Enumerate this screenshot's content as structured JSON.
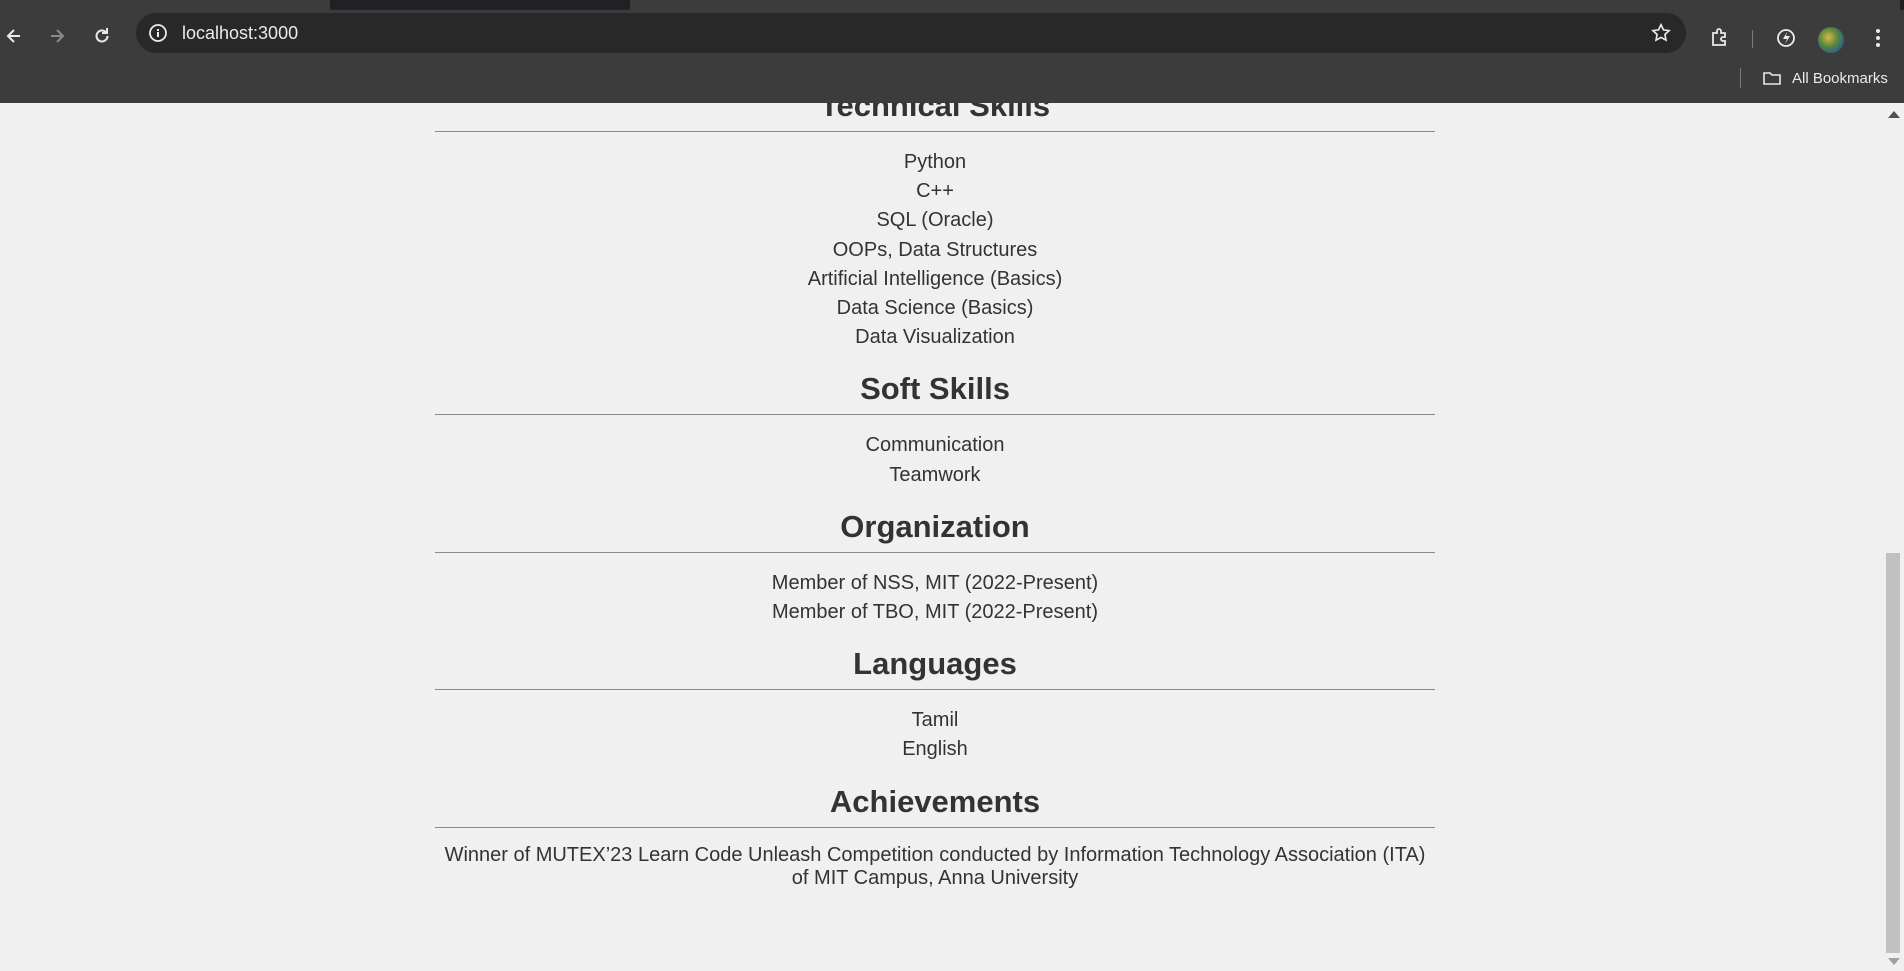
{
  "browser": {
    "url": "localhost:3000",
    "bookmarks_label": "All Bookmarks",
    "icons": [
      "back-icon",
      "forward-icon",
      "reload-icon",
      "site-info-icon",
      "bookmark-star-icon",
      "extensions-icon",
      "performance-icon",
      "profile-avatar",
      "menu-icon",
      "folder-icon"
    ]
  },
  "sections": {
    "technical": {
      "title": "Technical Skills",
      "items": [
        "Python",
        "C++",
        "SQL (Oracle)",
        "OOPs, Data Structures",
        "Artificial Intelligence (Basics)",
        "Data Science (Basics)",
        "Data Visualization"
      ]
    },
    "soft": {
      "title": "Soft Skills",
      "items": [
        "Communication",
        "Teamwork"
      ]
    },
    "organization": {
      "title": "Organization",
      "items": [
        "Member of NSS, MIT (2022-Present)",
        "Member of TBO, MIT (2022-Present)"
      ]
    },
    "languages": {
      "title": "Languages",
      "items": [
        "Tamil",
        "English"
      ]
    },
    "achievements": {
      "title": "Achievements",
      "items": [
        "Winner of MUTEX’23 Learn Code Unleash Competition conducted by Information Technology Association (ITA) of MIT Campus, Anna University"
      ]
    }
  }
}
